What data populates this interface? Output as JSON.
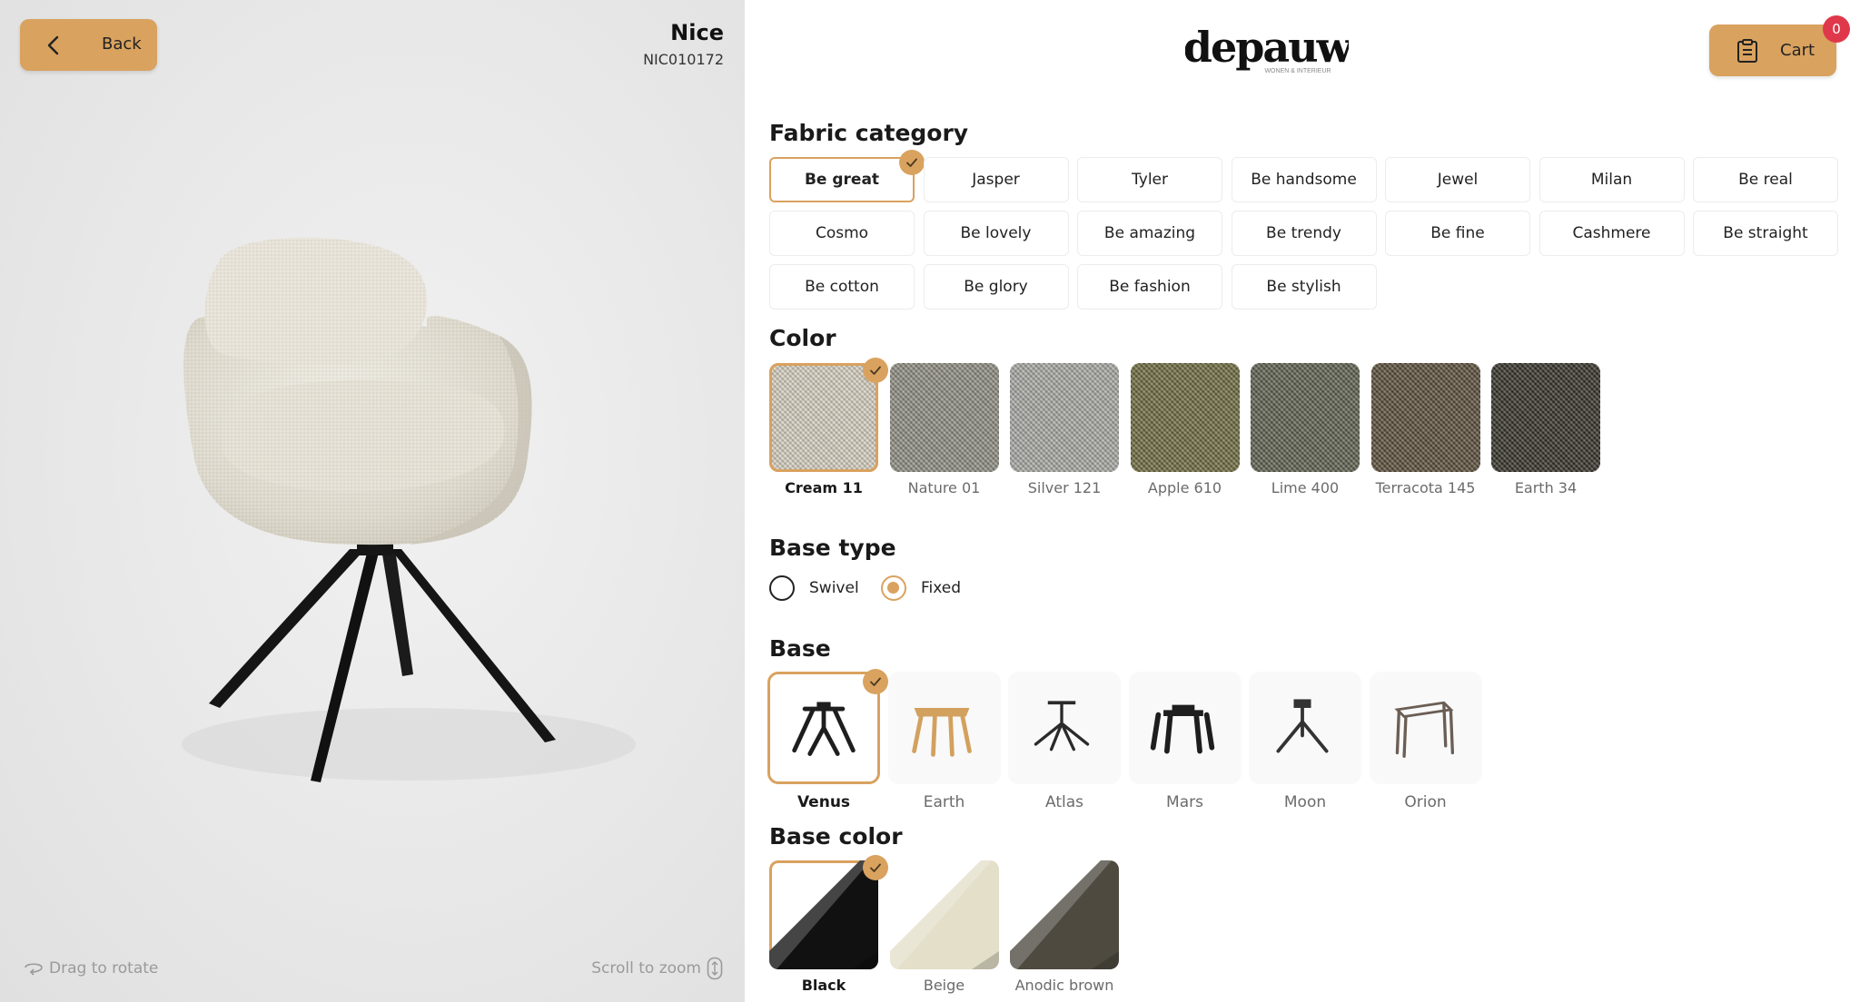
{
  "header": {
    "back_label": "Back",
    "product_name": "Nice",
    "product_code": "NIC010172",
    "logo_text": "depauw",
    "logo_tagline": "WONEN & INTERIEUR",
    "cart_label": "Cart",
    "cart_count": "0"
  },
  "viewer": {
    "drag_hint": "Drag to rotate",
    "zoom_hint": "Scroll to zoom"
  },
  "fabric": {
    "title": "Fabric category",
    "selected": "Be great",
    "options": [
      "Be great",
      "Jasper",
      "Tyler",
      "Be handsome",
      "Jewel",
      "Milan",
      "Be real",
      "Cosmo",
      "Be lovely",
      "Be amazing",
      "Be trendy",
      "Be fine",
      "Cashmere",
      "Be straight",
      "Be cotton",
      "Be glory",
      "Be fashion",
      "Be stylish"
    ]
  },
  "color": {
    "title": "Color",
    "selected": "Cream 11",
    "options": [
      {
        "label": "Cream 11",
        "hex": "#d6cfc0"
      },
      {
        "label": "Nature 01",
        "hex": "#8e8d82"
      },
      {
        "label": "Silver 121",
        "hex": "#a7a7a2"
      },
      {
        "label": "Apple 610",
        "hex": "#6d6b3f"
      },
      {
        "label": "Lime 400",
        "hex": "#5d6150"
      },
      {
        "label": "Terracota 145",
        "hex": "#5b4f3c"
      },
      {
        "label": "Earth 34",
        "hex": "#35332a"
      }
    ]
  },
  "base_type": {
    "title": "Base type",
    "options": [
      "Swivel",
      "Fixed"
    ],
    "selected": "Fixed"
  },
  "base": {
    "title": "Base",
    "selected": "Venus",
    "options": [
      {
        "label": "Venus",
        "color": "#1e1e1e"
      },
      {
        "label": "Earth",
        "color": "#d2a15e"
      },
      {
        "label": "Atlas",
        "color": "#2a2a2a"
      },
      {
        "label": "Mars",
        "color": "#1e1e1e"
      },
      {
        "label": "Moon",
        "color": "#333333"
      },
      {
        "label": "Orion",
        "color": "#6b5e55"
      }
    ]
  },
  "base_color": {
    "title": "Base color",
    "selected": "Black",
    "options": [
      {
        "label": "Black",
        "hex": "#111111"
      },
      {
        "label": "Beige",
        "hex": "#e3dfc9"
      },
      {
        "label": "Anodic brown",
        "hex": "#4e4a40"
      }
    ]
  },
  "colors": {
    "accent": "#d9a25f",
    "badge": "#e0384b"
  }
}
